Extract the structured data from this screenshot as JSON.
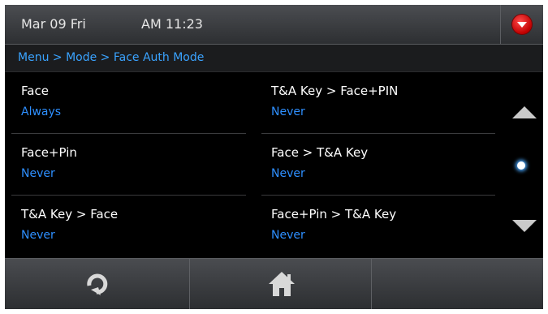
{
  "status_bar": {
    "date": "Mar 09 Fri",
    "time": "AM 11:23",
    "menu_icon": "dropdown-circle-icon"
  },
  "breadcrumb": "Menu > Mode > Face Auth Mode",
  "settings": [
    {
      "title": "Face",
      "value": "Always"
    },
    {
      "title": "T&A Key > Face+PIN",
      "value": "Never"
    },
    {
      "title": "Face+Pin",
      "value": "Never"
    },
    {
      "title": "Face > T&A Key",
      "value": "Never"
    },
    {
      "title": "T&A Key > Face",
      "value": "Never"
    },
    {
      "title": "Face+Pin > T&A Key",
      "value": "Never"
    }
  ],
  "scroll": {
    "up_icon": "arrow-up-icon",
    "position_icon": "page-indicator-dot-icon",
    "down_icon": "arrow-down-icon"
  },
  "bottom_bar": {
    "refresh_icon": "refresh-icon",
    "home_icon": "home-icon"
  },
  "colors": {
    "accent": "#2e8fff",
    "menu_button": "#d10000"
  }
}
